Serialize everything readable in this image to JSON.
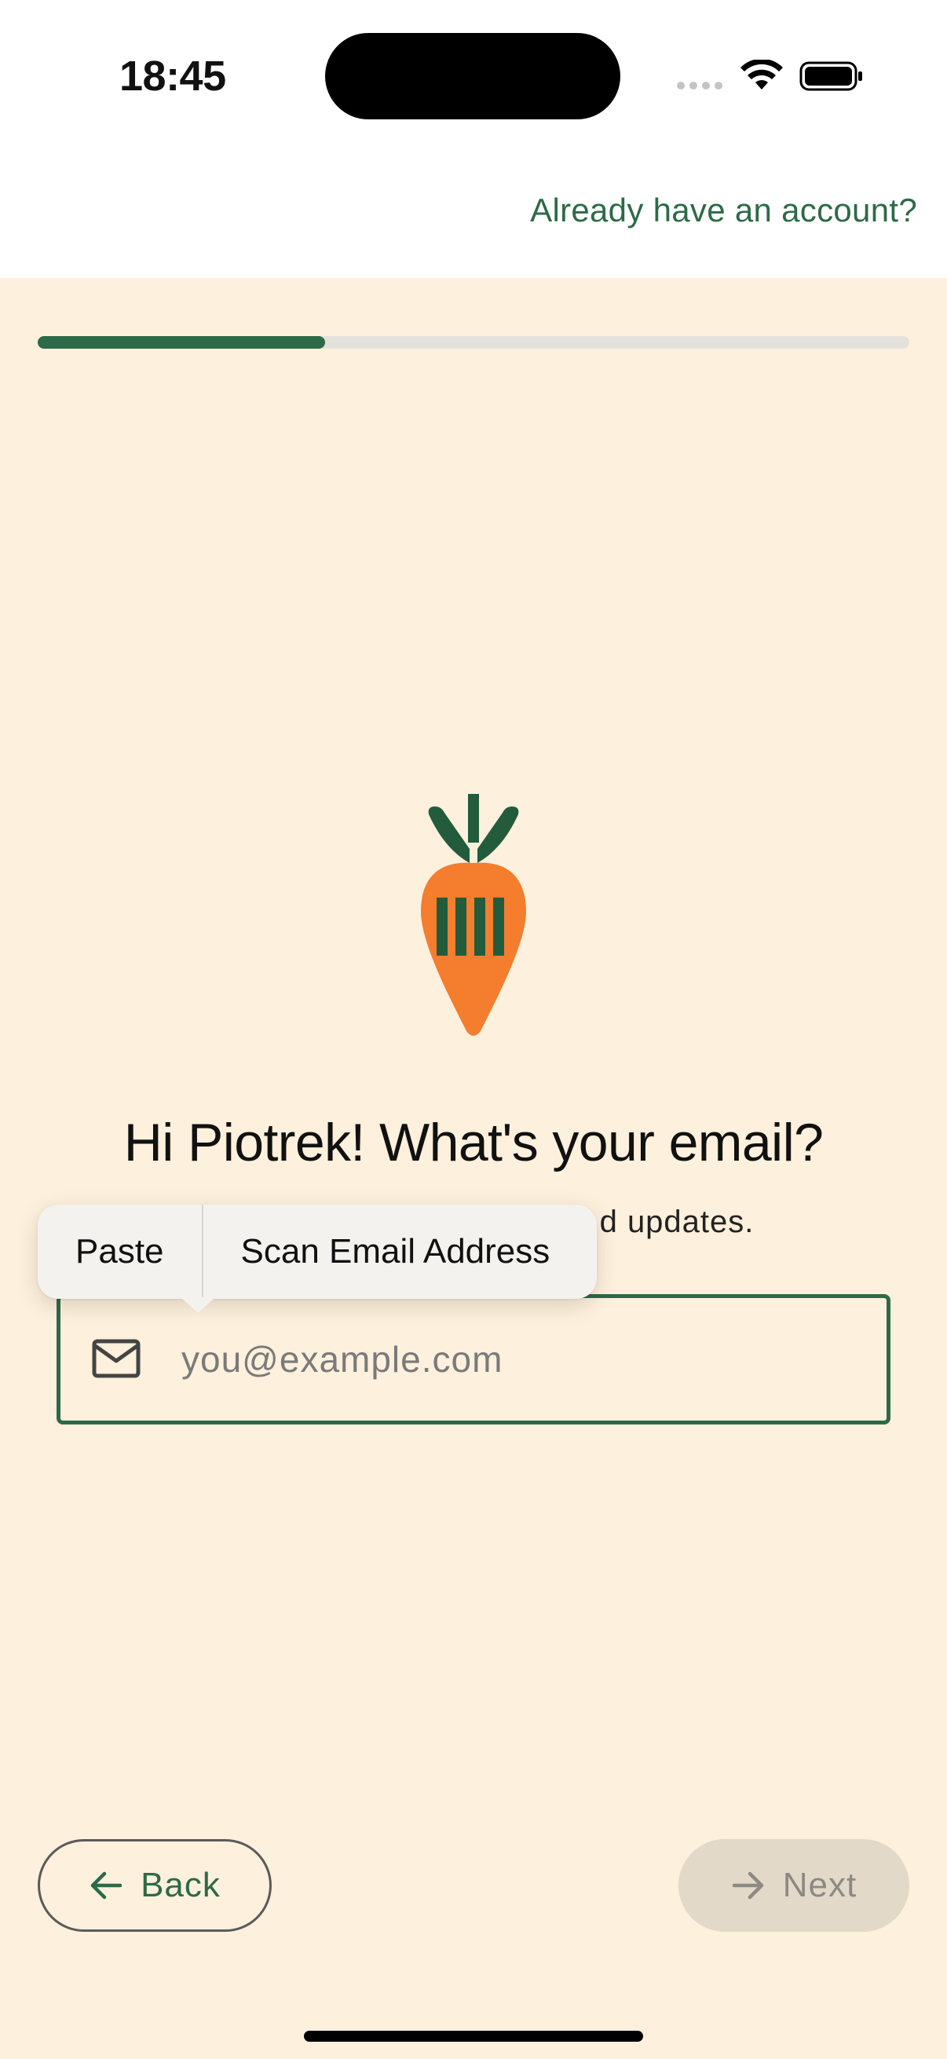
{
  "status_bar": {
    "time": "18:45"
  },
  "header": {
    "login_link": "Already have an account?"
  },
  "progress": {
    "value": 0.33,
    "fill_color": "#2d6a47"
  },
  "main": {
    "headline": "Hi Piotrek! What's your email?",
    "subline_visible_fragment": "d updates.",
    "email_field": {
      "label": "Email",
      "placeholder": "you@example.com",
      "value": ""
    }
  },
  "edit_menu": {
    "paste_label": "Paste",
    "scan_label": "Scan Email Address"
  },
  "footer": {
    "back_label": "Back",
    "next_label": "Next"
  },
  "colors": {
    "accent": "#2d6a47",
    "background": "#fdf0dc",
    "carrot": "#f47d2e"
  },
  "icons": [
    "carrot-logo-icon",
    "mail-icon",
    "arrow-left-icon",
    "arrow-right-icon",
    "wifi-icon",
    "battery-icon"
  ]
}
